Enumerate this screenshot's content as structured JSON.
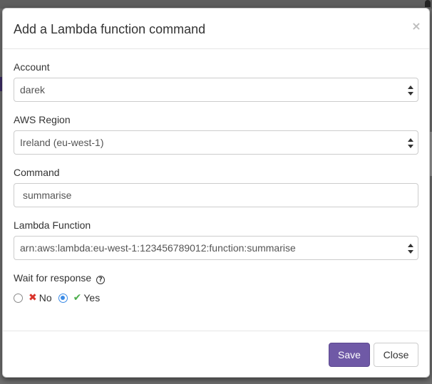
{
  "modal": {
    "title": "Add a Lambda function command",
    "close_symbol": "×"
  },
  "form": {
    "account": {
      "label": "Account",
      "value": "darek"
    },
    "region": {
      "label": "AWS Region",
      "value": "Ireland (eu-west-1)"
    },
    "command": {
      "label": "Command",
      "value": "summarise"
    },
    "lambda_function": {
      "label": "Lambda Function",
      "value": "arn:aws:lambda:eu-west-1:123456789012:function:summarise"
    },
    "wait_for_response": {
      "label": "Wait for response",
      "help_symbol": "?",
      "options": [
        {
          "label": "No",
          "icon": "x-icon",
          "checked": false
        },
        {
          "label": "Yes",
          "icon": "check-icon",
          "checked": true
        }
      ]
    }
  },
  "footer": {
    "save_label": "Save",
    "close_label": "Close"
  },
  "colors": {
    "primary": "#6f59a6",
    "no_icon": "#d9332b",
    "yes_icon": "#4cae4c",
    "radio_checked": "#3b8be6"
  }
}
